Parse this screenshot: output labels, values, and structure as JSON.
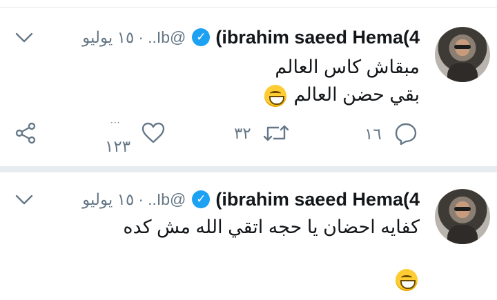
{
  "tweets": [
    {
      "name": "(ibrahim saeed Hema(4",
      "handle": "..Ib@",
      "date": "١٥ يوليو",
      "separator": "·",
      "lines": [
        "مبقاش كاس العالم",
        "بقي حضن العالم"
      ],
      "emoji": "grinning-face",
      "reply_count": "١٦",
      "retweet_count": "٣٢",
      "like_count": "١٢٣",
      "like_dots": "···"
    },
    {
      "name": "(ibrahim saeed Hema(4",
      "handle": "..Ib@",
      "date": "١٥ يوليو",
      "separator": "·",
      "lines": [
        "كفايه احضان يا حجه اتقي الله مش كده"
      ],
      "emoji": "grinning-face"
    }
  ],
  "colors": {
    "accent": "#1da1f2",
    "muted": "#657786",
    "text": "#14171a",
    "divider": "#e6ecf0"
  }
}
